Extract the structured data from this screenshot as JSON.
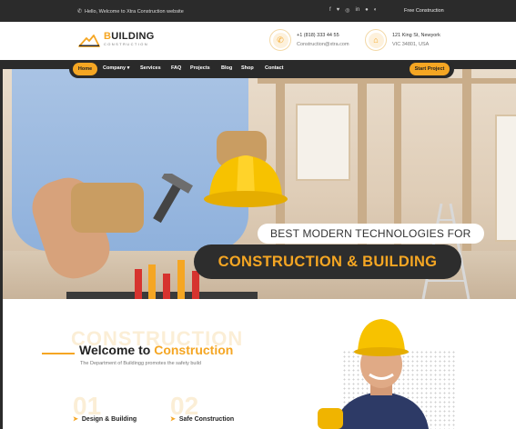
{
  "topbar": {
    "welcome": "Hello, Welcome to Xtra Construction website",
    "socials": [
      "facebook-icon",
      "twitter-icon",
      "instagram-icon",
      "linkedin-icon",
      "pinterest-icon",
      "skype-icon"
    ],
    "free": "Free Construction"
  },
  "header": {
    "brand_accent": "B",
    "brand_rest": "UILDING",
    "brand_sub": "CONSTRUCTION",
    "phone": "+1 (818) 333 44 55",
    "email": "Construction@xtra.com",
    "address1": "121 King St, Newyork",
    "address2": "VIC 34801, USA"
  },
  "nav": {
    "home": "Home",
    "company": "Company",
    "services": "Services",
    "faq": "FAQ",
    "projects": "Projects",
    "blog": "Blog",
    "shop": "Shop",
    "contact": "Contact",
    "start": "Start Project"
  },
  "hero": {
    "caption1": "BEST MODERN TECHNOLOGIES FOR",
    "caption2": "CONSTRUCTION & BUILDING"
  },
  "welcome": {
    "watermark": "CONSTRUCTION",
    "title_plain": "Welcome to ",
    "title_accent": "Construction",
    "tagline": "The Department of Buildingg promotes the safety build",
    "services": [
      {
        "num": "01",
        "label": "Design & Building"
      },
      {
        "num": "02",
        "label": "Safe Construction"
      }
    ]
  },
  "colors": {
    "accent": "#f5a623",
    "dark": "#2b2b2b"
  }
}
